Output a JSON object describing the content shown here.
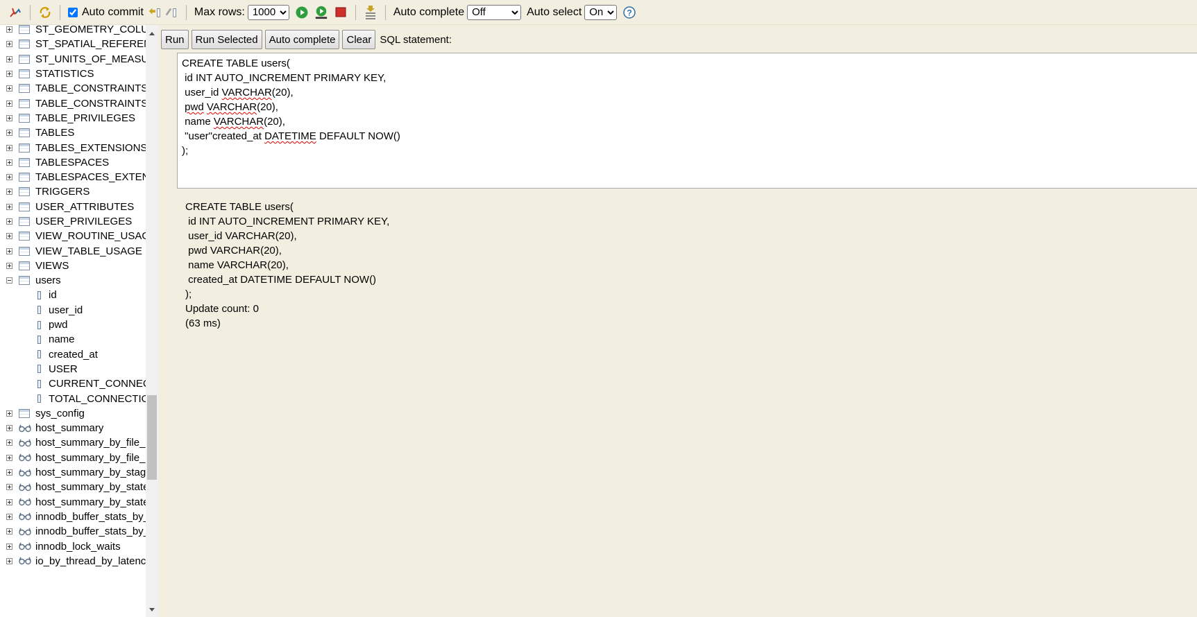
{
  "toolbar": {
    "auto_commit_label": "Auto commit",
    "auto_commit_checked": true,
    "max_rows_label": "Max rows:",
    "max_rows_value": "1000",
    "auto_complete_label": "Auto complete",
    "auto_complete_value": "Off",
    "auto_select_label": "Auto select",
    "auto_select_value": "On"
  },
  "sidebar": {
    "rows": [
      {
        "kind": "table",
        "expander": "plus",
        "label": "ST_GEOMETRY_COLUMNS"
      },
      {
        "kind": "table",
        "expander": "plus",
        "label": "ST_SPATIAL_REFERENCE_SYSTEMS"
      },
      {
        "kind": "table",
        "expander": "plus",
        "label": "ST_UNITS_OF_MEASURE"
      },
      {
        "kind": "table",
        "expander": "plus",
        "label": "STATISTICS"
      },
      {
        "kind": "table",
        "expander": "plus",
        "label": "TABLE_CONSTRAINTS"
      },
      {
        "kind": "table",
        "expander": "plus",
        "label": "TABLE_CONSTRAINTS_EXTENSIONS"
      },
      {
        "kind": "table",
        "expander": "plus",
        "label": "TABLE_PRIVILEGES"
      },
      {
        "kind": "table",
        "expander": "plus",
        "label": "TABLES"
      },
      {
        "kind": "table",
        "expander": "plus",
        "label": "TABLES_EXTENSIONS"
      },
      {
        "kind": "table",
        "expander": "plus",
        "label": "TABLESPACES"
      },
      {
        "kind": "table",
        "expander": "plus",
        "label": "TABLESPACES_EXTENSIONS"
      },
      {
        "kind": "table",
        "expander": "plus",
        "label": "TRIGGERS"
      },
      {
        "kind": "table",
        "expander": "plus",
        "label": "USER_ATTRIBUTES"
      },
      {
        "kind": "table",
        "expander": "plus",
        "label": "USER_PRIVILEGES"
      },
      {
        "kind": "table",
        "expander": "plus",
        "label": "VIEW_ROUTINE_USAGE"
      },
      {
        "kind": "table",
        "expander": "plus",
        "label": "VIEW_TABLE_USAGE"
      },
      {
        "kind": "table",
        "expander": "plus",
        "label": "VIEWS"
      },
      {
        "kind": "table",
        "expander": "minus",
        "label": "users"
      },
      {
        "kind": "column",
        "label": "id"
      },
      {
        "kind": "column",
        "label": "user_id"
      },
      {
        "kind": "column",
        "label": "pwd"
      },
      {
        "kind": "column",
        "label": "name"
      },
      {
        "kind": "column",
        "label": "created_at"
      },
      {
        "kind": "column",
        "label": "USER"
      },
      {
        "kind": "column",
        "label": "CURRENT_CONNECTIONS"
      },
      {
        "kind": "column",
        "label": "TOTAL_CONNECTIONS"
      },
      {
        "kind": "table",
        "expander": "plus",
        "label": "sys_config"
      },
      {
        "kind": "view",
        "expander": "plus",
        "label": "host_summary"
      },
      {
        "kind": "view",
        "expander": "plus",
        "label": "host_summary_by_file_io"
      },
      {
        "kind": "view",
        "expander": "plus",
        "label": "host_summary_by_file_io_type"
      },
      {
        "kind": "view",
        "expander": "plus",
        "label": "host_summary_by_stages"
      },
      {
        "kind": "view",
        "expander": "plus",
        "label": "host_summary_by_statement_latency"
      },
      {
        "kind": "view",
        "expander": "plus",
        "label": "host_summary_by_statement_type"
      },
      {
        "kind": "view",
        "expander": "plus",
        "label": "innodb_buffer_stats_by_schema"
      },
      {
        "kind": "view",
        "expander": "plus",
        "label": "innodb_buffer_stats_by_table"
      },
      {
        "kind": "view",
        "expander": "plus",
        "label": "innodb_lock_waits"
      },
      {
        "kind": "view",
        "expander": "plus",
        "label": "io_by_thread_by_latency"
      }
    ]
  },
  "buttons": {
    "run": "Run",
    "run_selected": "Run Selected",
    "auto_complete": "Auto complete",
    "clear": "Clear",
    "sql_statement_label": "SQL statement:"
  },
  "editor": {
    "lines": [
      [
        {
          "t": "CREATE TABLE users("
        }
      ],
      [
        {
          "t": " id INT AUTO_INCREMENT PRIMARY KEY,"
        }
      ],
      [
        {
          "t": " user_id "
        },
        {
          "t": "VARCHAR",
          "err": true
        },
        {
          "t": "(20),"
        }
      ],
      [
        {
          "t": " "
        },
        {
          "t": "pwd",
          "err": true
        },
        {
          "t": " "
        },
        {
          "t": "VARCHAR",
          "err": true
        },
        {
          "t": "(20),"
        }
      ],
      [
        {
          "t": " name "
        },
        {
          "t": "VARCHAR",
          "err": true
        },
        {
          "t": "(20),"
        }
      ],
      [
        {
          "t": " \"user\"created_at "
        },
        {
          "t": "DATETIME",
          "err": true
        },
        {
          "t": " DEFAULT NOW()"
        }
      ],
      [
        {
          "t": ");"
        }
      ]
    ]
  },
  "output": {
    "lines": [
      "CREATE TABLE users(",
      " id INT AUTO_INCREMENT PRIMARY KEY,",
      " user_id VARCHAR(20),",
      " pwd VARCHAR(20),",
      " name VARCHAR(20),",
      " created_at DATETIME DEFAULT NOW()",
      ");",
      "Update count: 0",
      "(63 ms)"
    ]
  }
}
